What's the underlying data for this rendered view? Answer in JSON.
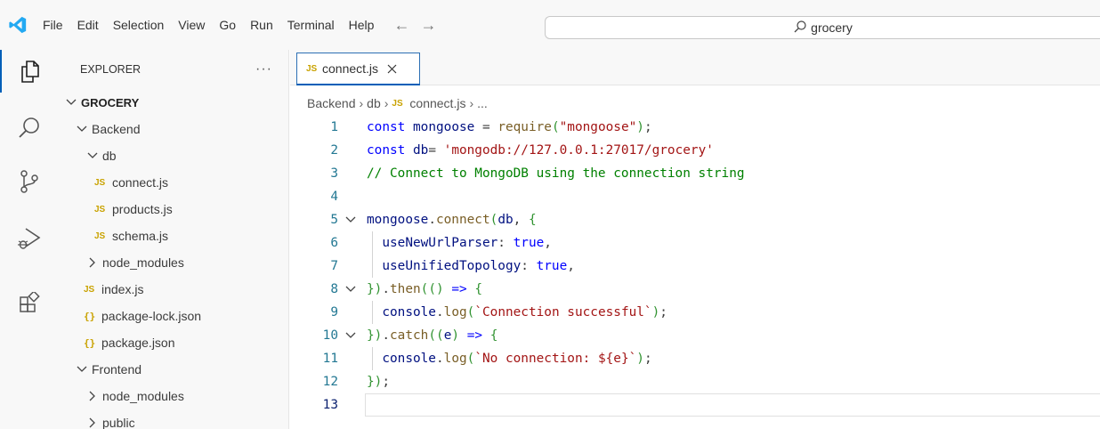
{
  "menubar": {
    "items": [
      "File",
      "Edit",
      "Selection",
      "View",
      "Go",
      "Run",
      "Terminal",
      "Help"
    ],
    "back_icon": "arrow-left-icon",
    "forward_icon": "arrow-right-icon"
  },
  "command_center": {
    "text": "grocery"
  },
  "activity_bar": {
    "icons": [
      "explorer-icon",
      "search-icon",
      "source-control-icon",
      "run-debug-icon",
      "extensions-icon"
    ]
  },
  "explorer": {
    "title": "EXPLORER",
    "more": "···",
    "tree": {
      "root": "GROCERY",
      "backend": "Backend",
      "db": "db",
      "connect": "connect.js",
      "products": "products.js",
      "schema": "schema.js",
      "backend_node_modules": "node_modules",
      "index": "index.js",
      "package_lock": "package-lock.json",
      "package": "package.json",
      "frontend": "Frontend",
      "frontend_node_modules": "node_modules",
      "public": "public"
    },
    "js_badge": "JS",
    "json_badge": "{}"
  },
  "editor": {
    "tab": {
      "label": "connect.js",
      "badge": "JS"
    },
    "breadcrumb": {
      "part1": "Backend",
      "part2": "db",
      "badge": "JS",
      "file": "connect.js",
      "ellipsis": "...",
      "sep": "›"
    },
    "current_line": 13,
    "lines": [
      {
        "n": "1",
        "text": "const mongoose = require(\"mongoose\");"
      },
      {
        "n": "2",
        "text": "const db= 'mongodb://127.0.0.1:27017/grocery'"
      },
      {
        "n": "3",
        "text": "// Connect to MongoDB using the connection string"
      },
      {
        "n": "4",
        "text": ""
      },
      {
        "n": "5",
        "text": "mongoose.connect(db, {"
      },
      {
        "n": "6",
        "text": "  useNewUrlParser: true,"
      },
      {
        "n": "7",
        "text": "  useUnifiedTopology: true,"
      },
      {
        "n": "8",
        "text": "}).then(() => {"
      },
      {
        "n": "9",
        "text": "  console.log(`Connection successful`);"
      },
      {
        "n": "10",
        "text": "}).catch((e) => {"
      },
      {
        "n": "11",
        "text": "  console.log(`No connection: ${e}`);"
      },
      {
        "n": "12",
        "text": "});"
      },
      {
        "n": "13",
        "text": ""
      }
    ]
  },
  "colors": {
    "accent": "#005fb8",
    "logo_blue": "#23a9f2",
    "js_yellow": "#c9a200",
    "keyword": "#0000ff",
    "identifier": "#001080",
    "function": "#795e26",
    "string": "#a31515",
    "comment": "#008000",
    "control": "#af00db",
    "number": "#098658",
    "line_number": "#237893"
  }
}
